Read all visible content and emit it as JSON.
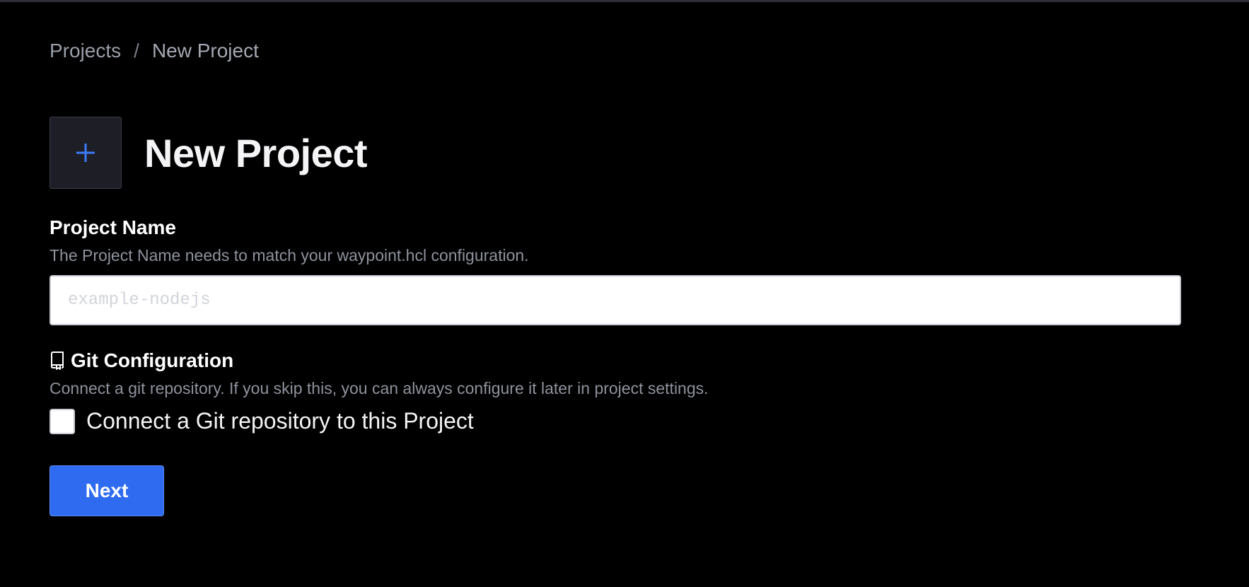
{
  "breadcrumb": {
    "parent": "Projects",
    "separator": "/",
    "current": "New Project"
  },
  "header": {
    "icon": "plus-icon",
    "title": "New Project",
    "accent_color": "#3e7bf6"
  },
  "project_name": {
    "label": "Project Name",
    "helper": "The Project Name needs to match your waypoint.hcl configuration.",
    "placeholder": "example-nodejs",
    "value": ""
  },
  "git_configuration": {
    "icon": "book-icon",
    "label": "Git Configuration",
    "helper": "Connect a git repository. If you skip this, you can always configure it later in project settings.",
    "checkbox_label": "Connect a Git repository to this Project",
    "checked": false
  },
  "actions": {
    "next_label": "Next",
    "button_color": "#2f6bf0"
  }
}
